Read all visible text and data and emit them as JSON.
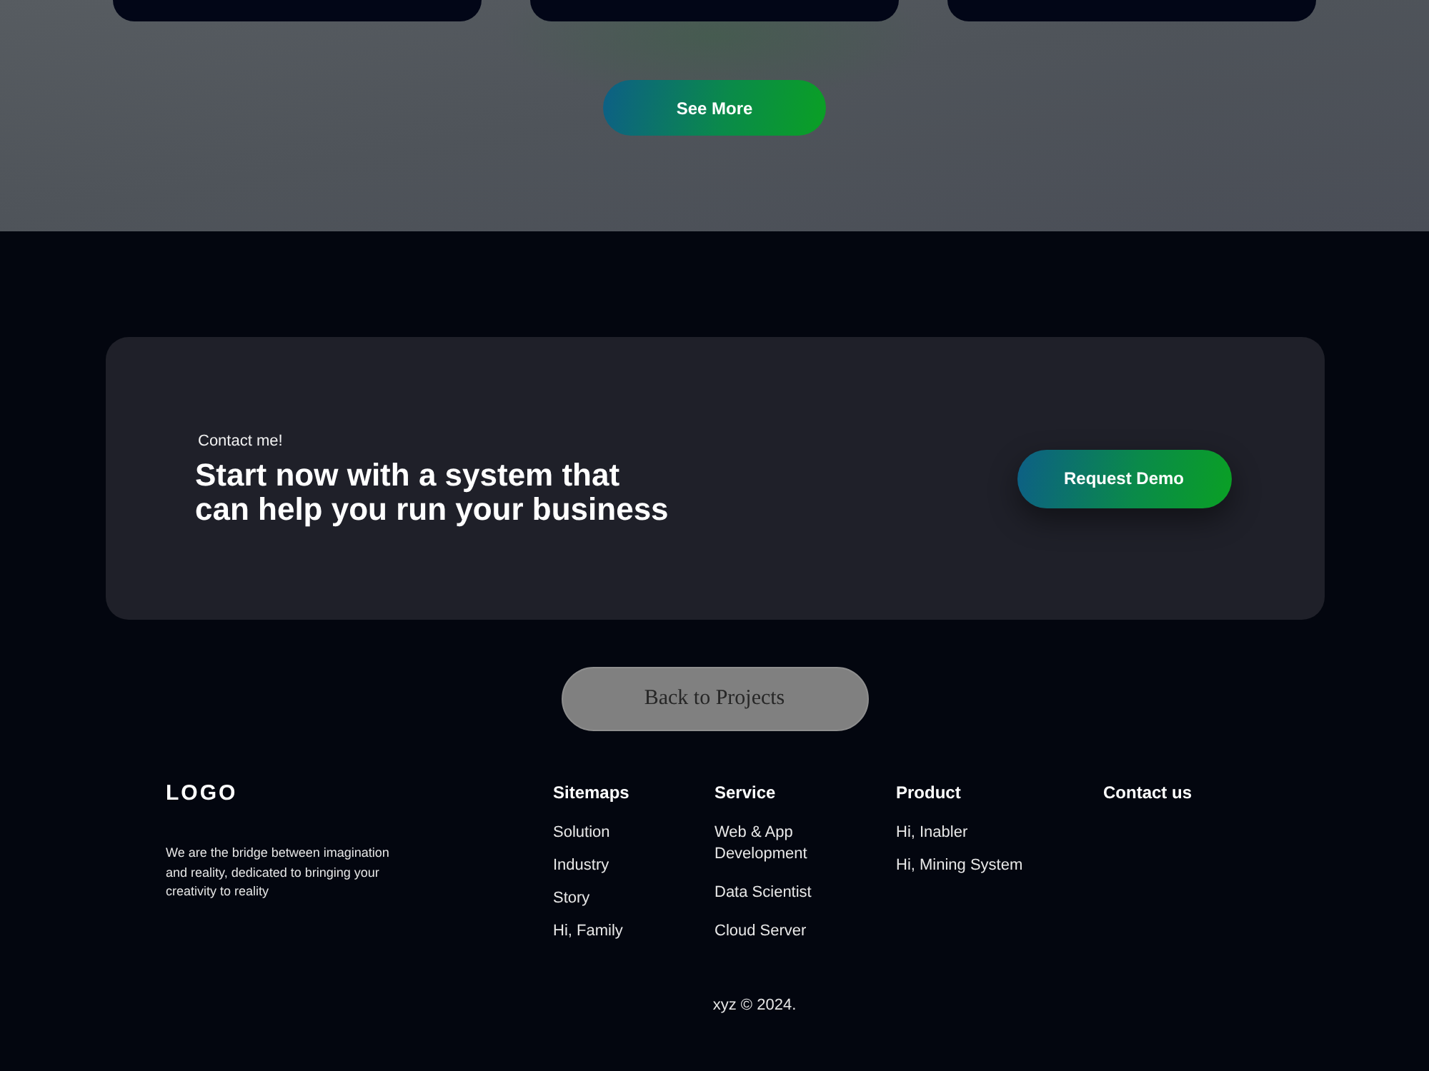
{
  "see_more_button": "See More",
  "cta": {
    "eyebrow": "Contact me!",
    "heading": "Start now with a system that can help you run your business",
    "button": "Request Demo"
  },
  "back_button": "Back to Projects",
  "footer": {
    "logo": "LOGO",
    "description": "We are the bridge between imagination and reality, dedicated to bringing your creativity to reality",
    "columns": [
      {
        "heading": "Sitemaps",
        "links": [
          "Solution",
          "Industry",
          "Story",
          "Hi, Family"
        ]
      },
      {
        "heading": "Service",
        "links": [
          "Web & App Development",
          "Data Scientist",
          "Cloud Server"
        ]
      },
      {
        "heading": "Product",
        "links": [
          "Hi, Inabler",
          "Hi, Mining System"
        ]
      },
      {
        "heading": "Contact us"
      }
    ]
  },
  "copyright": "xyz © 2024."
}
